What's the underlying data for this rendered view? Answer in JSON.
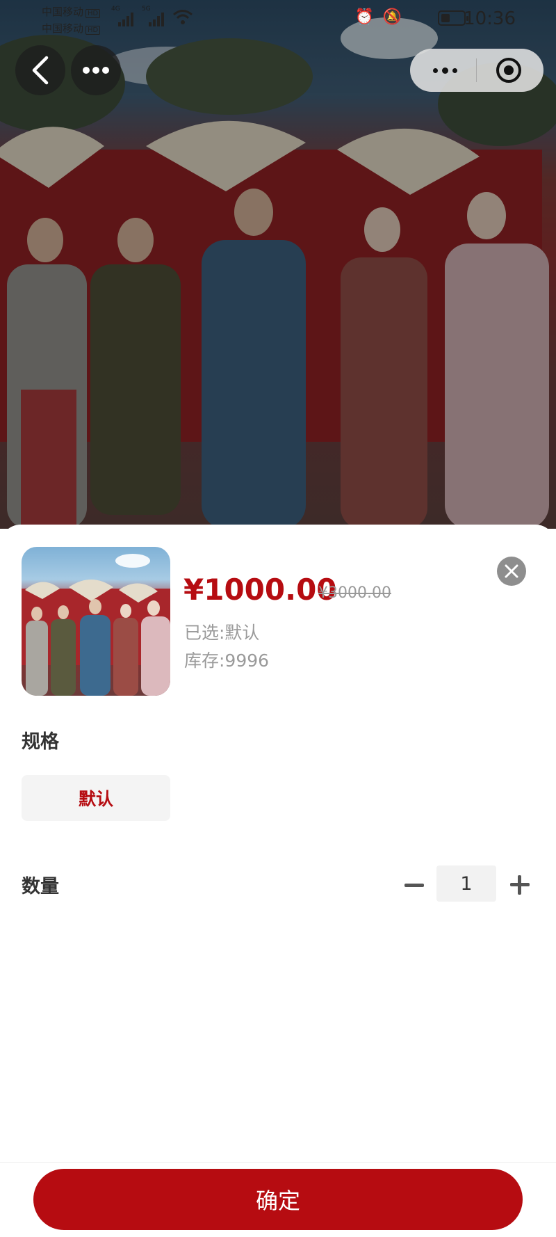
{
  "status_bar": {
    "carrier1": "中国移动",
    "carrier2": "中国移动",
    "hd_badge": "HD",
    "net1": "4G",
    "net2": "5G",
    "time": "10:36",
    "battery_level": 0.4
  },
  "nav": {
    "back_icon": "chevron-left-icon",
    "more_icon": "more-horizontal-icon",
    "capsule_menu_icon": "more-dots-icon",
    "capsule_close_icon": "target-icon"
  },
  "product": {
    "price": "¥1000.00",
    "original_price": "¥3000.00",
    "selected_text": "已选:默认",
    "stock_text": "库存:9996"
  },
  "spec": {
    "title": "规格",
    "options": [
      "默认"
    ],
    "selected_index": 0
  },
  "quantity": {
    "title": "数量",
    "value": "1"
  },
  "confirm_button": "确定",
  "colors": {
    "accent": "#b60c11",
    "muted_text": "#9a9a9a",
    "chip_bg": "#f4f4f4"
  }
}
